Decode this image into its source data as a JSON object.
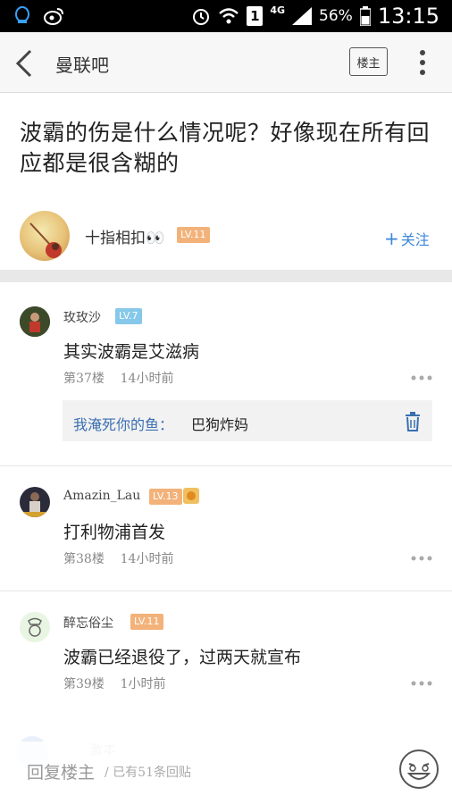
{
  "status_bar": {
    "network": "4G",
    "battery": "56%",
    "time": "13:15",
    "sim_label": "1"
  },
  "nav": {
    "title": "曼联吧",
    "louzhu_label": "楼主",
    "icons": [
      "back-icon",
      "more-icon"
    ]
  },
  "post": {
    "title": "波霸的伤是什么情况呢？好像现在所有回应都是很含糊的",
    "author": "十指相扣👀",
    "author_level": "LV.11",
    "follow_label": "关注"
  },
  "replies": [
    {
      "name": "玫玫沙",
      "level": "LV.7",
      "content": "其实波霸是艾滋病",
      "floor": "第37楼",
      "time": "14小时前",
      "sub_reply": {
        "user": "我淹死你的鱼：",
        "text": "巴狗炸妈"
      }
    },
    {
      "name": "Amazin_Lau",
      "level": "LV.13",
      "content": "打利物浦首发",
      "floor": "第38楼",
      "time": "14小时前"
    },
    {
      "name": "醉忘俗尘",
      "level": "LV.11",
      "content": "波霸已经退役了，过两天就宣布",
      "floor": "第39楼",
      "time": "1小时前"
    }
  ],
  "partial_reply": {
    "name": "激本"
  },
  "bottom_bar": {
    "input_label": "回复楼主",
    "reply_count": "/ 已有51条回贴"
  }
}
